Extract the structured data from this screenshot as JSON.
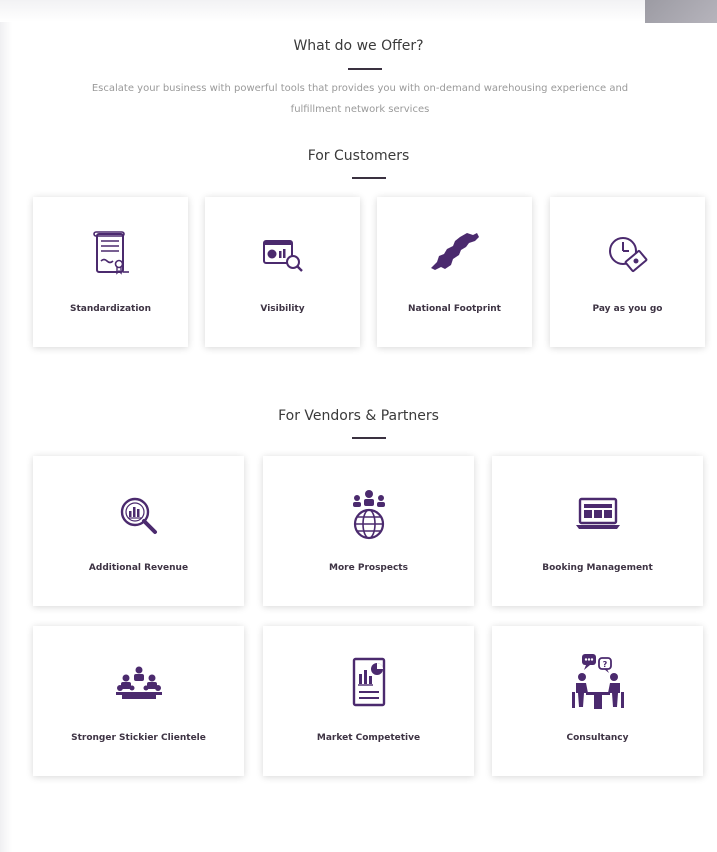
{
  "header": {
    "title": "What do we Offer?",
    "subtitle_line1": "Escalate your business with powerful tools that provides you with on-demand warehousing experience and",
    "subtitle_line2": "fulfillment network services"
  },
  "customers": {
    "title": "For Customers",
    "cards": [
      {
        "label": "Standardization",
        "icon": "document-certificate-icon"
      },
      {
        "label": "Visibility",
        "icon": "dashboard-search-icon"
      },
      {
        "label": "National Footprint",
        "icon": "pakistan-map-icon"
      },
      {
        "label": "Pay as you go",
        "icon": "clock-money-icon"
      }
    ]
  },
  "vendors": {
    "title": "For Vendors & Partners",
    "cards": [
      {
        "label": "Additional Revenue",
        "icon": "revenue-magnifier-icon"
      },
      {
        "label": "More Prospects",
        "icon": "globe-people-icon"
      },
      {
        "label": "Booking Management",
        "icon": "laptop-booking-icon"
      },
      {
        "label": "Stronger Stickier Clientele",
        "icon": "meeting-group-icon"
      },
      {
        "label": "Market Competetive",
        "icon": "report-chart-icon"
      },
      {
        "label": "Consultancy",
        "icon": "consultancy-icon"
      }
    ]
  },
  "colors": {
    "accent": "#4b2a6e",
    "heading": "#3a3a3a",
    "subtitle": "#9a9a9a",
    "label": "#3e3444"
  }
}
